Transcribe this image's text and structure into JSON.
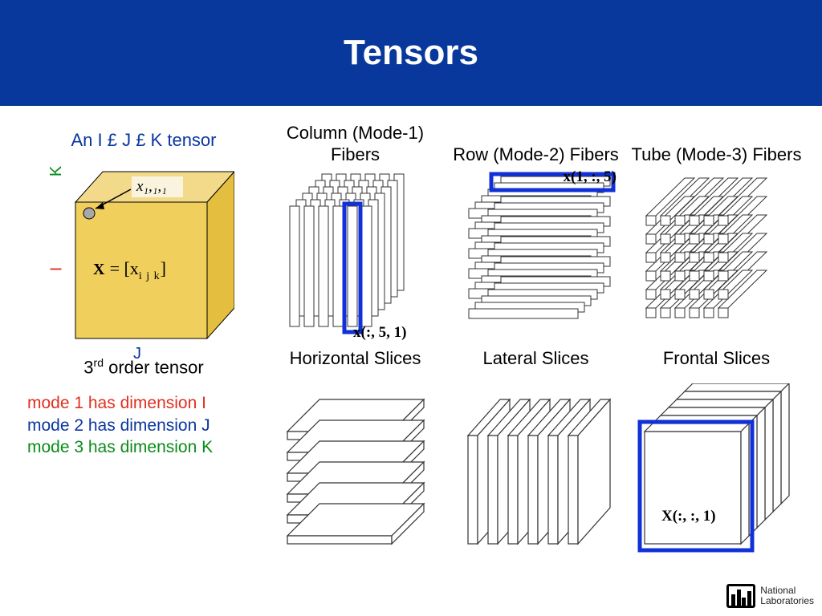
{
  "title": "Tensors",
  "left": {
    "heading": "An I £ J £ K tensor",
    "axis_i": "I",
    "axis_j": "J",
    "axis_k": "K",
    "corner_label": "x₁,₁,₁",
    "x_equals": "X",
    "eq": "=  [x",
    "sub": "i j k",
    "closeb": "]",
    "order_pre": "3",
    "order_sup": "rd",
    "order_post": " order tensor",
    "mode1": "mode 1 has dimension I",
    "mode2": "mode 2 has dimension J",
    "mode3": "mode 3 has dimension K"
  },
  "grid": {
    "col1": {
      "label": "Column (Mode-1) Fibers",
      "ann": "x(:, 5, 1)"
    },
    "col2": {
      "label": "Row (Mode-2) Fibers",
      "ann": "x(1, :, 5)"
    },
    "col3": {
      "label": "Tube (Mode-3) Fibers"
    },
    "col4": {
      "label": "Horizontal Slices"
    },
    "col5": {
      "label": "Lateral Slices"
    },
    "col6": {
      "label": "Frontal Slices",
      "ann": "X(:, :, 1)"
    }
  },
  "logo": {
    "line1": "National",
    "line2": "Laboratories"
  }
}
